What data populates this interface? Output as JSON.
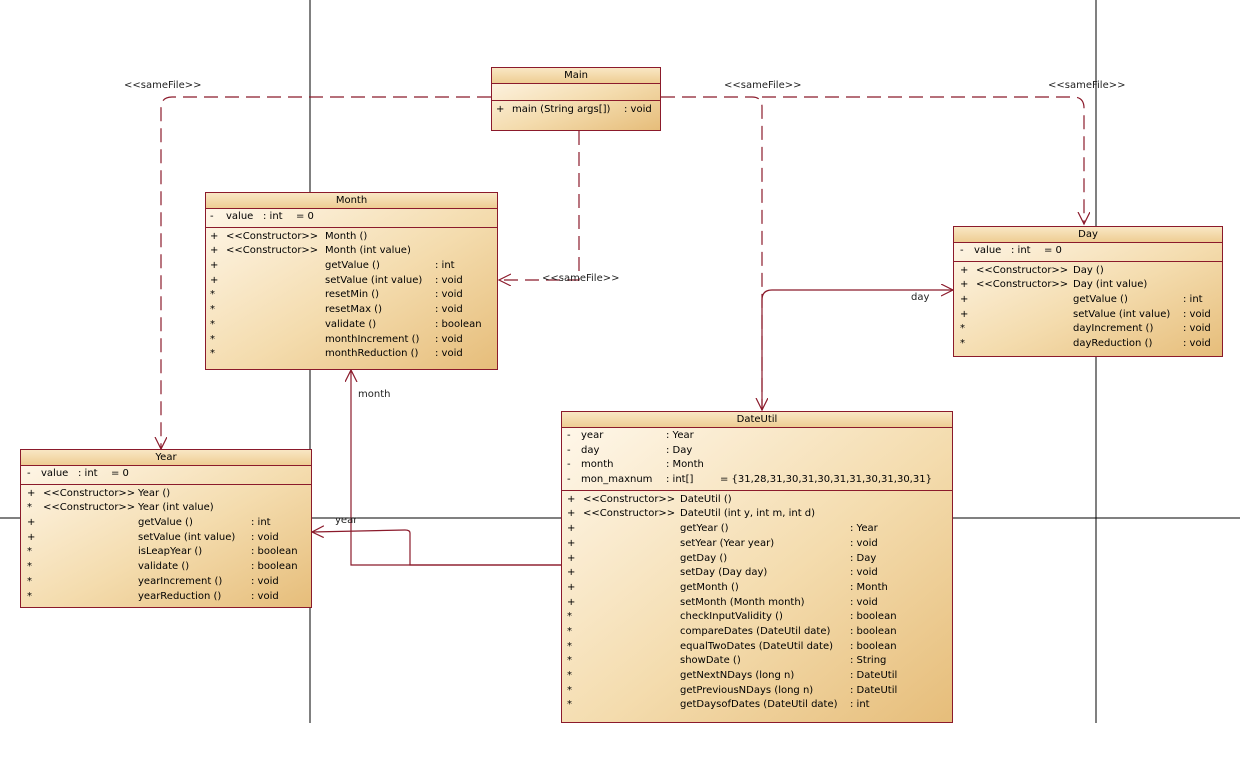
{
  "classes": {
    "main": {
      "name": "Main",
      "attributes": [],
      "operations": [
        {
          "vis": "+",
          "name": "main (String args[])",
          "type": ": void"
        }
      ]
    },
    "month": {
      "name": "Month",
      "attributes": [
        {
          "vis": "-",
          "name": "value",
          "type": ": int",
          "init": "= 0"
        }
      ],
      "operations": [
        {
          "vis": "+",
          "stereo": "<<Constructor>>",
          "name": "Month ()",
          "type": ""
        },
        {
          "vis": "+",
          "stereo": "<<Constructor>>",
          "name": "Month (int value)",
          "type": ""
        },
        {
          "vis": "+",
          "name": "getValue ()",
          "type": ": int"
        },
        {
          "vis": "+",
          "name": "setValue (int value)",
          "type": ": void"
        },
        {
          "vis": "*",
          "name": "resetMin ()",
          "type": ": void"
        },
        {
          "vis": "*",
          "name": "resetMax ()",
          "type": ": void"
        },
        {
          "vis": "*",
          "name": "validate ()",
          "type": ": boolean"
        },
        {
          "vis": "*",
          "name": "monthIncrement ()",
          "type": ": void"
        },
        {
          "vis": "*",
          "name": "monthReduction ()",
          "type": ": void"
        }
      ]
    },
    "day": {
      "name": "Day",
      "attributes": [
        {
          "vis": "-",
          "name": "value",
          "type": ": int",
          "init": "= 0"
        }
      ],
      "operations": [
        {
          "vis": "+",
          "stereo": "<<Constructor>>",
          "name": "Day ()",
          "type": ""
        },
        {
          "vis": "+",
          "stereo": "<<Constructor>>",
          "name": "Day (int value)",
          "type": ""
        },
        {
          "vis": "+",
          "name": "getValue ()",
          "type": ": int"
        },
        {
          "vis": "+",
          "name": "setValue (int value)",
          "type": ": void"
        },
        {
          "vis": "*",
          "name": "dayIncrement ()",
          "type": ": void"
        },
        {
          "vis": "*",
          "name": "dayReduction ()",
          "type": ": void"
        }
      ]
    },
    "year": {
      "name": "Year",
      "attributes": [
        {
          "vis": "-",
          "name": "value",
          "type": ": int",
          "init": "= 0"
        }
      ],
      "operations": [
        {
          "vis": "+",
          "stereo": "<<Constructor>>",
          "name": "Year ()",
          "type": ""
        },
        {
          "vis": "*",
          "stereo": "<<Constructor>>",
          "name": "Year (int value)",
          "type": ""
        },
        {
          "vis": "+",
          "name": "getValue ()",
          "type": ": int"
        },
        {
          "vis": "+",
          "name": "setValue (int value)",
          "type": ": void"
        },
        {
          "vis": "*",
          "name": "isLeapYear ()",
          "type": ": boolean"
        },
        {
          "vis": "*",
          "name": "validate ()",
          "type": ": boolean"
        },
        {
          "vis": "*",
          "name": "yearIncrement ()",
          "type": ": void"
        },
        {
          "vis": "*",
          "name": "yearReduction ()",
          "type": ": void"
        }
      ]
    },
    "dateutil": {
      "name": "DateUtil",
      "attributes": [
        {
          "vis": "-",
          "name": "year",
          "type": ": Year",
          "init": ""
        },
        {
          "vis": "-",
          "name": "day",
          "type": ": Day",
          "init": ""
        },
        {
          "vis": "-",
          "name": "month",
          "type": ": Month",
          "init": ""
        },
        {
          "vis": "-",
          "name": "mon_maxnum",
          "type": ": int[]",
          "init": "= {31,28,31,30,31,30,31,31,30,31,30,31}"
        }
      ],
      "operations": [
        {
          "vis": "+",
          "stereo": "<<Constructor>>",
          "name": "DateUtil ()",
          "type": ""
        },
        {
          "vis": "+",
          "stereo": "<<Constructor>>",
          "name": "DateUtil (int y, int m, int d)",
          "type": ""
        },
        {
          "vis": "+",
          "name": "getYear ()",
          "type": ": Year"
        },
        {
          "vis": "+",
          "name": "setYear (Year year)",
          "type": ": void"
        },
        {
          "vis": "+",
          "name": "getDay ()",
          "type": ": Day"
        },
        {
          "vis": "+",
          "name": "setDay (Day day)",
          "type": ": void"
        },
        {
          "vis": "+",
          "name": "getMonth ()",
          "type": ": Month"
        },
        {
          "vis": "+",
          "name": "setMonth (Month month)",
          "type": ": void"
        },
        {
          "vis": "*",
          "name": "checkInputValidity ()",
          "type": ": boolean"
        },
        {
          "vis": "*",
          "name": "compareDates (DateUtil date)",
          "type": ": boolean"
        },
        {
          "vis": "*",
          "name": "equalTwoDates (DateUtil date)",
          "type": ": boolean"
        },
        {
          "vis": "*",
          "name": "showDate ()",
          "type": ": String"
        },
        {
          "vis": "*",
          "name": "getNextNDays (long n)",
          "type": ": DateUtil"
        },
        {
          "vis": "*",
          "name": "getPreviousNDays (long n)",
          "type": ": DateUtil"
        },
        {
          "vis": "*",
          "name": "getDaysofDates (DateUtil date)",
          "type": ": int"
        }
      ]
    }
  },
  "labels": {
    "samefile_year": "<<sameFile>>",
    "samefile_dateutil": "<<sameFile>>",
    "samefile_day": "<<sameFile>>",
    "samefile_month": "<<sameFile>>",
    "assoc_day": "day",
    "assoc_month": "month",
    "assoc_year": "year"
  },
  "colors": {
    "border": "#8b1a2b",
    "line": "#8b1a2b",
    "fill_light": "#fff8ec",
    "fill_dark": "#e6bd7a"
  }
}
